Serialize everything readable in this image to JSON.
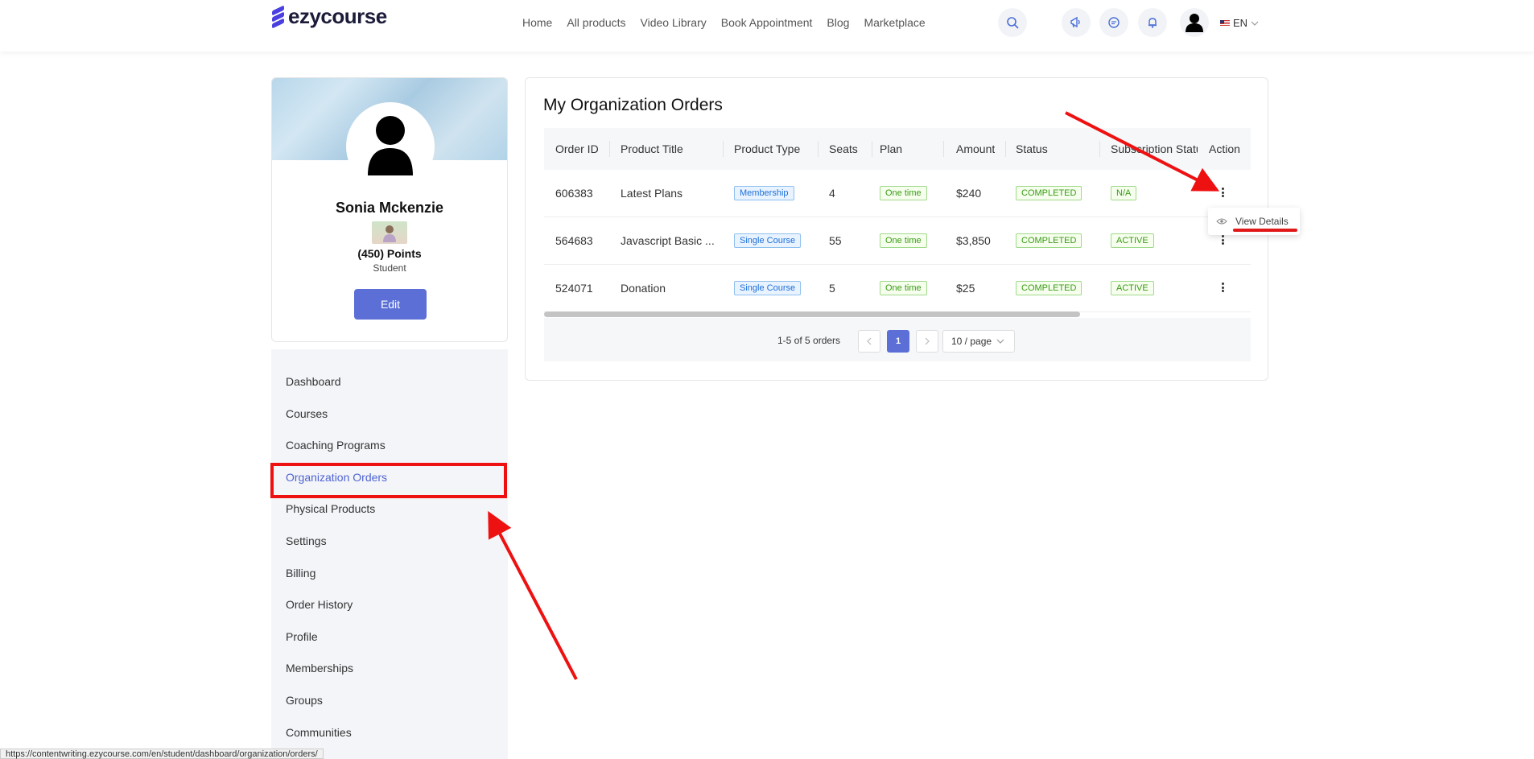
{
  "brand": {
    "name": "ezycourse",
    "color": "#4a3fe0"
  },
  "nav": [
    "Home",
    "All products",
    "Video Library",
    "Book Appointment",
    "Blog",
    "Marketplace"
  ],
  "header_icons": [
    "search-icon",
    "megaphone-icon",
    "chat-icon",
    "bell-icon",
    "user-avatar-icon"
  ],
  "language": {
    "code": "EN"
  },
  "profile": {
    "name": "Sonia Mckenzie",
    "points": "(450) Points",
    "role": "Student",
    "edit_label": "Edit"
  },
  "menu": [
    "Dashboard",
    "Courses",
    "Coaching Programs",
    "Organization Orders",
    "Physical Products",
    "Settings",
    "Billing",
    "Order History",
    "Profile",
    "Memberships",
    "Groups",
    "Communities"
  ],
  "menu_active": "Organization Orders",
  "orders": {
    "title": "My Organization Orders",
    "columns": [
      "Order ID",
      "Product Title",
      "Product Type",
      "Seats",
      "Plan",
      "Amount",
      "Status",
      "Subscription Status",
      "Action"
    ],
    "rows": [
      {
        "id": "606383",
        "title": "Latest Plans",
        "type": "Membership",
        "seats": "4",
        "plan": "One time",
        "amount": "$240",
        "status": "COMPLETED",
        "sub_status": "N/A"
      },
      {
        "id": "564683",
        "title": "Javascript Basic ...",
        "type": "Single Course",
        "seats": "55",
        "plan": "One time",
        "amount": "$3,850",
        "status": "COMPLETED",
        "sub_status": "ACTIVE"
      },
      {
        "id": "524071",
        "title": "Donation",
        "type": "Single Course",
        "seats": "5",
        "plan": "One time",
        "amount": "$25",
        "status": "COMPLETED",
        "sub_status": "ACTIVE"
      }
    ],
    "total_text": "1-5 of 5 orders",
    "current_page": "1",
    "page_size": "10 / page"
  },
  "popup": {
    "label": "View Details"
  },
  "status_url": "https://contentwriting.ezycourse.com/en/student/dashboard/organization/orders/",
  "colors": {
    "accent": "#5b6fd6",
    "annotation": "#ee1111"
  }
}
